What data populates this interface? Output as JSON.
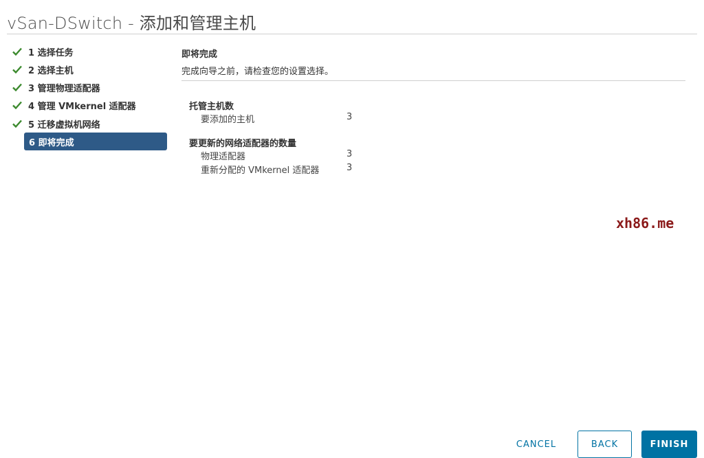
{
  "window": {
    "title": "vSan-DSwitch - 添加和管理主机"
  },
  "steps": [
    {
      "label": "1 选择任务",
      "done": true
    },
    {
      "label": "2 选择主机",
      "done": true
    },
    {
      "label": "3 管理物理适配器",
      "done": true
    },
    {
      "label": "4 管理 VMkernel 适配器",
      "done": true
    },
    {
      "label": "5 迁移虚拟机网络",
      "done": true
    },
    {
      "label": "6 即将完成",
      "done": false,
      "active": true
    }
  ],
  "content": {
    "heading": "即将完成",
    "description": "完成向导之前，请检查您的设置选择。",
    "sections": [
      {
        "title": "托管主机数",
        "rows": [
          {
            "label": "要添加的主机",
            "value": "3"
          }
        ]
      },
      {
        "title": "要更新的网络适配器的数量",
        "rows": [
          {
            "label": "物理适配器",
            "value": "3"
          },
          {
            "label": "重新分配的 VMkernel 适配器",
            "value": "3"
          }
        ]
      }
    ]
  },
  "watermark": "xh86.me",
  "buttons": {
    "cancel": "CANCEL",
    "back": "BACK",
    "finish": "FINISH"
  },
  "colors": {
    "check": "#3c8a2e",
    "active_step_bg": "#2e5a87",
    "primary": "#0072a3"
  }
}
